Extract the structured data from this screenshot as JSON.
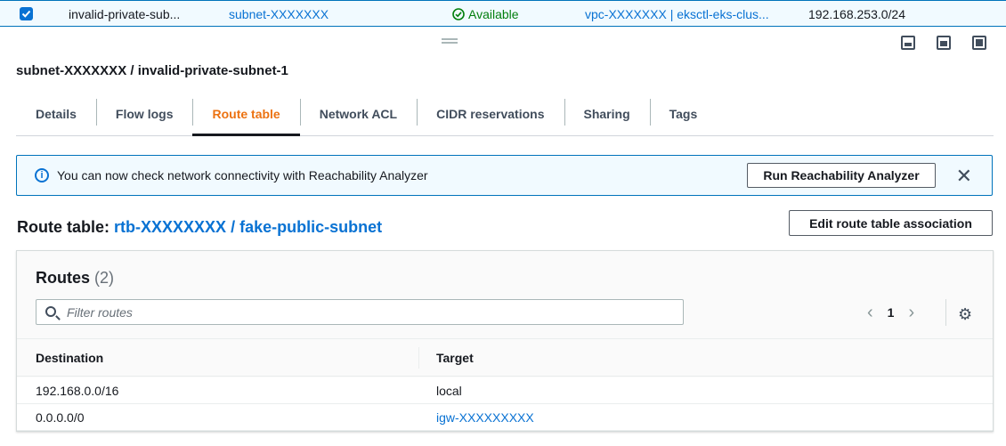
{
  "top_row": {
    "name": "invalid-private-sub...",
    "subnet_id": "subnet-XXXXXXX",
    "state": "Available",
    "vpc": "vpc-XXXXXXX | eksctl-eks-clus...",
    "cidr": "192.168.253.0/24"
  },
  "detail": {
    "title": "subnet-XXXXXXX / invalid-private-subnet-1"
  },
  "tabs": [
    {
      "label": "Details",
      "active": false
    },
    {
      "label": "Flow logs",
      "active": false
    },
    {
      "label": "Route table",
      "active": true
    },
    {
      "label": "Network ACL",
      "active": false
    },
    {
      "label": "CIDR reservations",
      "active": false
    },
    {
      "label": "Sharing",
      "active": false
    },
    {
      "label": "Tags",
      "active": false
    }
  ],
  "alert": {
    "message": "You can now check network connectivity with Reachability Analyzer",
    "button": "Run Reachability Analyzer"
  },
  "route_table": {
    "label": "Route table:",
    "link": "rtb-XXXXXXXX / fake-public-subnet",
    "edit_button": "Edit route table association"
  },
  "routes": {
    "heading": "Routes",
    "count": "(2)",
    "filter_placeholder": "Filter routes",
    "page": "1",
    "columns": [
      "Destination",
      "Target"
    ],
    "rows": [
      {
        "destination": "192.168.0.0/16",
        "target": "local"
      },
      {
        "destination": "0.0.0.0/0",
        "target": "igw-XXXXXXXXX"
      }
    ]
  },
  "colors": {
    "accent": "#0972d3",
    "active_tab": "#ec7211",
    "success": "#037f0c"
  }
}
